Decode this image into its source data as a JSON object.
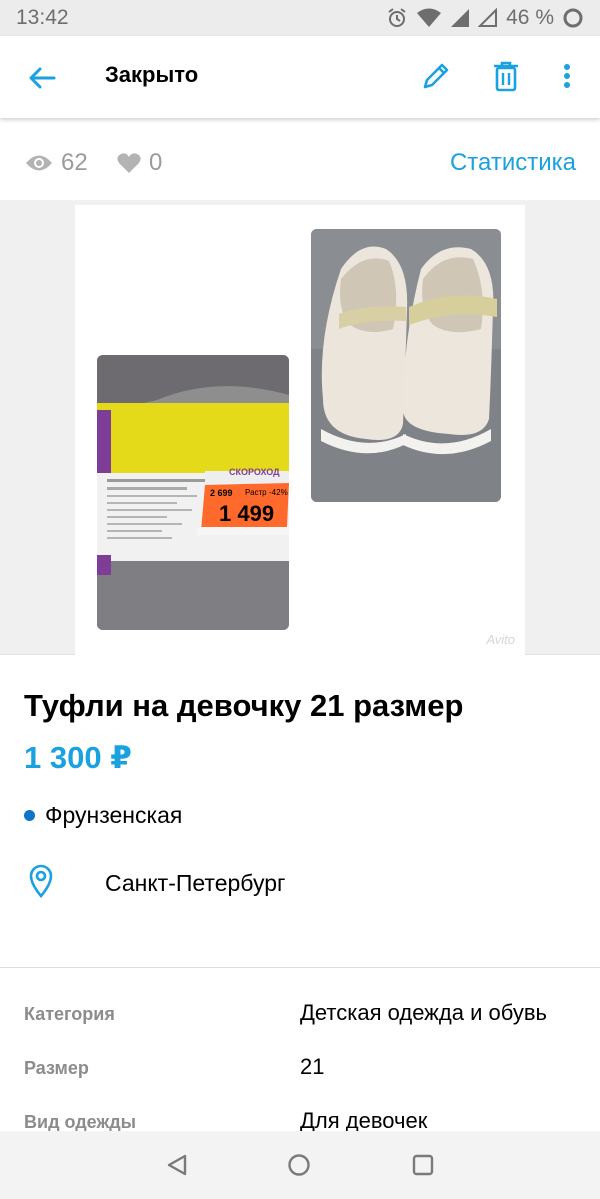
{
  "status_bar": {
    "time": "13:42",
    "battery": "46 %"
  },
  "app_bar": {
    "title": "Закрыто"
  },
  "stats": {
    "views": "62",
    "likes": "0",
    "statistics_link": "Статистика"
  },
  "gallery": {
    "watermark": "Avito",
    "box_price_tag": "1 499",
    "box_price_tag_small": "2 699",
    "box_brand": "СКОРОХОД",
    "box_discount": "-42%",
    "box_label": "Растр"
  },
  "item": {
    "title": "Туфли на девочку 21 размер",
    "price": "1 300 ₽",
    "metro": "Фрунзенская",
    "metro_color": "#0c75c7",
    "city": "Санкт-Петербург"
  },
  "params": [
    {
      "key": "Категория",
      "value": "Детская одежда и обувь"
    },
    {
      "key": "Размер",
      "value": "21"
    },
    {
      "key": "Вид одежды",
      "value": "Для девочек"
    }
  ],
  "colors": {
    "accent": "#1aa1e0",
    "muted": "#9b9b9b"
  }
}
